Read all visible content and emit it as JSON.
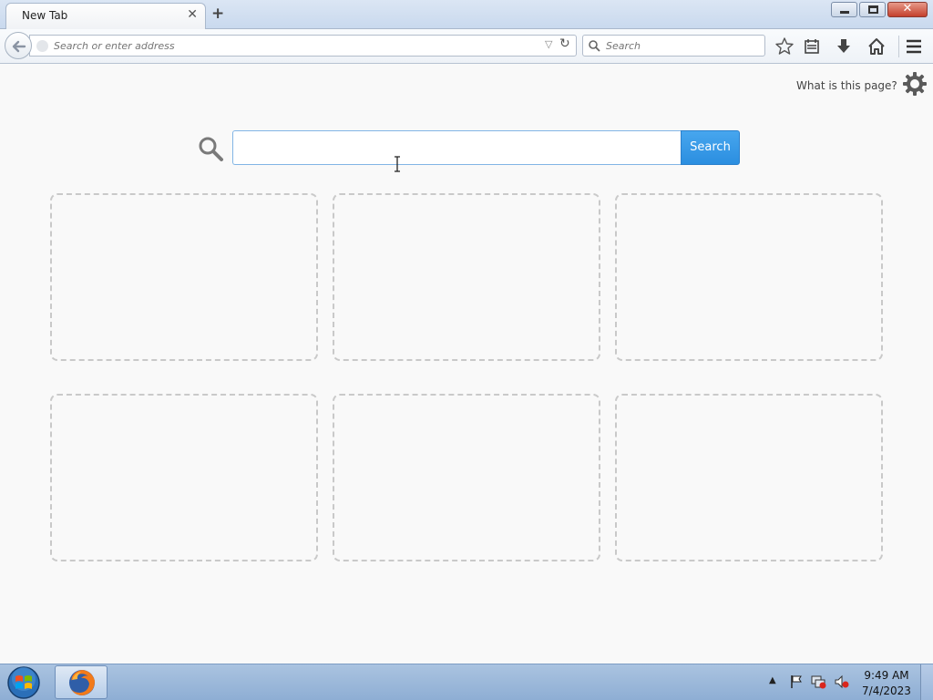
{
  "tab": {
    "title": "New Tab"
  },
  "nav": {
    "url_placeholder": "Search or enter address",
    "search_placeholder": "Search"
  },
  "page": {
    "what_is_link": "What is this page?",
    "search_button": "Search",
    "tile_count": 6
  },
  "taskbar": {
    "time": "9:49 AM",
    "date": "7/4/2023"
  },
  "colors": {
    "accent": "#2b8ee0",
    "tile_border": "#c9c9c9",
    "taskbar": "#9fbadd"
  },
  "icons": [
    "back-arrow-icon",
    "reload-icon",
    "star-icon",
    "reading-list-icon",
    "download-icon",
    "home-icon",
    "menu-icon",
    "gear-icon",
    "search-icon",
    "firefox-icon",
    "windows-orb-icon",
    "flag-icon",
    "network-icon",
    "volume-muted-icon"
  ]
}
